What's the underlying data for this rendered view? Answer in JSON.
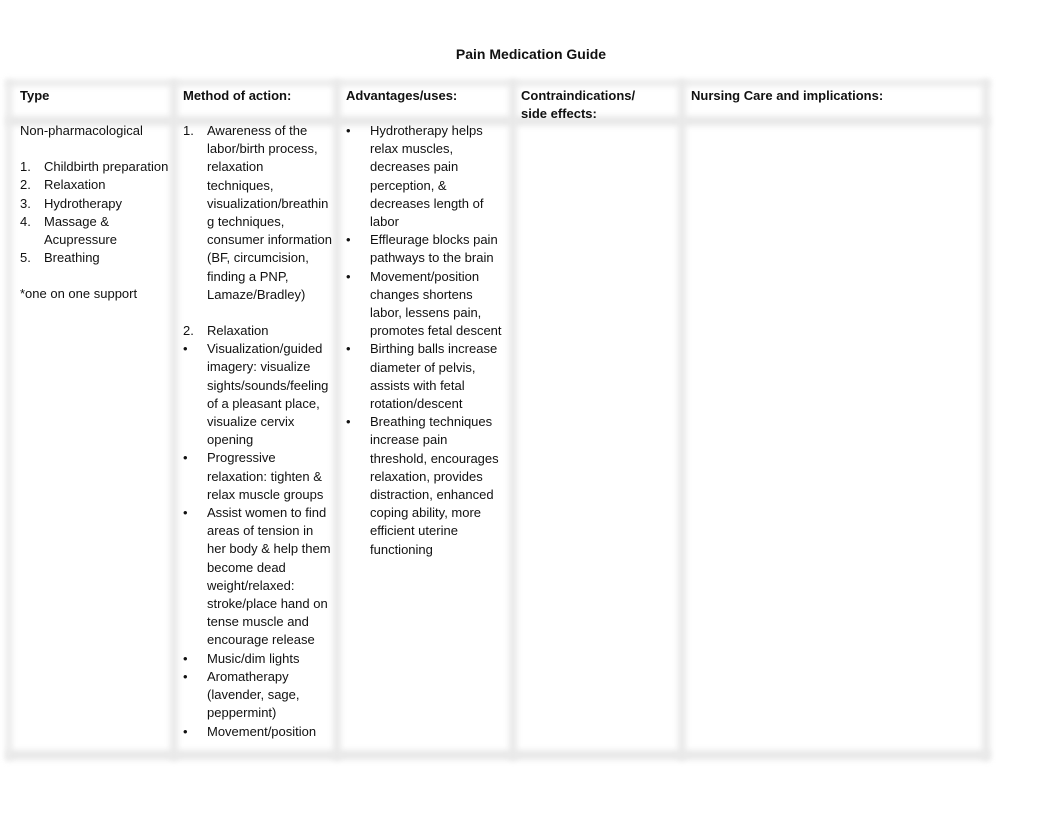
{
  "document": {
    "title": "Pain Medication Guide"
  },
  "table": {
    "headers": {
      "type": "Type",
      "method": "Method of action:",
      "advantages": "Advantages/uses:",
      "contraindications_line1": "Contraindications/",
      "contraindications_line2": "side effects:",
      "nursing": "Nursing Care and implications:"
    },
    "type_cell": {
      "category": "Non-pharmacological",
      "items": [
        {
          "marker": "1.",
          "text": "Childbirth preparation"
        },
        {
          "marker": "2.",
          "text": "Relaxation"
        },
        {
          "marker": "3.",
          "text": "Hydrotherapy"
        },
        {
          "marker": "4.",
          "text": "Massage & Acupressure"
        },
        {
          "marker": "5.",
          "text": "Breathing"
        }
      ],
      "note": "*one on one support"
    },
    "method_cell": {
      "item1": {
        "marker": "1.",
        "text": "Awareness of the labor/birth process, relaxation techniques, visualization/breathing techniques, consumer information (BF, circumcision, finding a PNP, Lamaze/Bradley)"
      },
      "item2": {
        "marker": "2.",
        "text": "Relaxation"
      },
      "bullet_marker": "•",
      "bullets": [
        "Visualization/guided imagery: visualize sights/sounds/feeling of a pleasant place, visualize cervix opening",
        "Progressive relaxation: tighten & relax muscle groups",
        "Assist women to find areas of tension in her body & help them become dead weight/relaxed: stroke/place hand on tense muscle and encourage release",
        "Music/dim lights",
        "Aromatherapy (lavender, sage, peppermint)",
        "Movement/position"
      ]
    },
    "advantages_cell": {
      "bullet_marker": "•",
      "bullets": [
        "Hydrotherapy helps relax muscles, decreases pain perception, & decreases length of labor",
        "Effleurage blocks pain pathways to the brain",
        "Movement/position changes shortens labor, lessens pain, promotes fetal descent",
        "Birthing balls increase diameter of pelvis, assists with fetal rotation/descent",
        "Breathing techniques increase pain threshold, encourages relaxation, provides distraction, enhanced coping ability, more efficient uterine functioning"
      ]
    },
    "contraindications_cell": "",
    "nursing_cell": ""
  }
}
